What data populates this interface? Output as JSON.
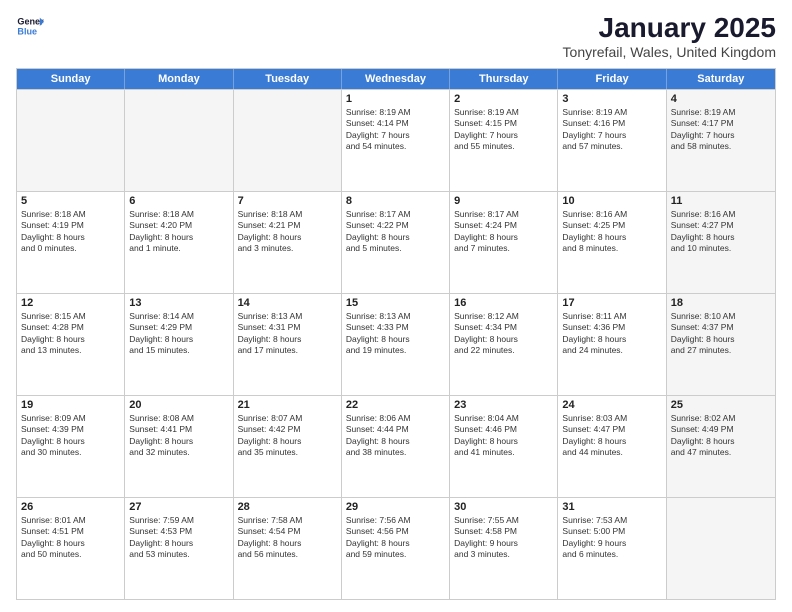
{
  "logo": {
    "line1": "General",
    "line2": "Blue"
  },
  "title": "January 2025",
  "subtitle": "Tonyrefail, Wales, United Kingdom",
  "header_days": [
    "Sunday",
    "Monday",
    "Tuesday",
    "Wednesday",
    "Thursday",
    "Friday",
    "Saturday"
  ],
  "weeks": [
    [
      {
        "day": "",
        "lines": [],
        "shaded": true
      },
      {
        "day": "",
        "lines": [],
        "shaded": true
      },
      {
        "day": "",
        "lines": [],
        "shaded": true
      },
      {
        "day": "1",
        "lines": [
          "Sunrise: 8:19 AM",
          "Sunset: 4:14 PM",
          "Daylight: 7 hours",
          "and 54 minutes."
        ]
      },
      {
        "day": "2",
        "lines": [
          "Sunrise: 8:19 AM",
          "Sunset: 4:15 PM",
          "Daylight: 7 hours",
          "and 55 minutes."
        ]
      },
      {
        "day": "3",
        "lines": [
          "Sunrise: 8:19 AM",
          "Sunset: 4:16 PM",
          "Daylight: 7 hours",
          "and 57 minutes."
        ]
      },
      {
        "day": "4",
        "lines": [
          "Sunrise: 8:19 AM",
          "Sunset: 4:17 PM",
          "Daylight: 7 hours",
          "and 58 minutes."
        ],
        "shaded": true
      }
    ],
    [
      {
        "day": "5",
        "lines": [
          "Sunrise: 8:18 AM",
          "Sunset: 4:19 PM",
          "Daylight: 8 hours",
          "and 0 minutes."
        ]
      },
      {
        "day": "6",
        "lines": [
          "Sunrise: 8:18 AM",
          "Sunset: 4:20 PM",
          "Daylight: 8 hours",
          "and 1 minute."
        ]
      },
      {
        "day": "7",
        "lines": [
          "Sunrise: 8:18 AM",
          "Sunset: 4:21 PM",
          "Daylight: 8 hours",
          "and 3 minutes."
        ]
      },
      {
        "day": "8",
        "lines": [
          "Sunrise: 8:17 AM",
          "Sunset: 4:22 PM",
          "Daylight: 8 hours",
          "and 5 minutes."
        ]
      },
      {
        "day": "9",
        "lines": [
          "Sunrise: 8:17 AM",
          "Sunset: 4:24 PM",
          "Daylight: 8 hours",
          "and 7 minutes."
        ]
      },
      {
        "day": "10",
        "lines": [
          "Sunrise: 8:16 AM",
          "Sunset: 4:25 PM",
          "Daylight: 8 hours",
          "and 8 minutes."
        ]
      },
      {
        "day": "11",
        "lines": [
          "Sunrise: 8:16 AM",
          "Sunset: 4:27 PM",
          "Daylight: 8 hours",
          "and 10 minutes."
        ],
        "shaded": true
      }
    ],
    [
      {
        "day": "12",
        "lines": [
          "Sunrise: 8:15 AM",
          "Sunset: 4:28 PM",
          "Daylight: 8 hours",
          "and 13 minutes."
        ]
      },
      {
        "day": "13",
        "lines": [
          "Sunrise: 8:14 AM",
          "Sunset: 4:29 PM",
          "Daylight: 8 hours",
          "and 15 minutes."
        ]
      },
      {
        "day": "14",
        "lines": [
          "Sunrise: 8:13 AM",
          "Sunset: 4:31 PM",
          "Daylight: 8 hours",
          "and 17 minutes."
        ]
      },
      {
        "day": "15",
        "lines": [
          "Sunrise: 8:13 AM",
          "Sunset: 4:33 PM",
          "Daylight: 8 hours",
          "and 19 minutes."
        ]
      },
      {
        "day": "16",
        "lines": [
          "Sunrise: 8:12 AM",
          "Sunset: 4:34 PM",
          "Daylight: 8 hours",
          "and 22 minutes."
        ]
      },
      {
        "day": "17",
        "lines": [
          "Sunrise: 8:11 AM",
          "Sunset: 4:36 PM",
          "Daylight: 8 hours",
          "and 24 minutes."
        ]
      },
      {
        "day": "18",
        "lines": [
          "Sunrise: 8:10 AM",
          "Sunset: 4:37 PM",
          "Daylight: 8 hours",
          "and 27 minutes."
        ],
        "shaded": true
      }
    ],
    [
      {
        "day": "19",
        "lines": [
          "Sunrise: 8:09 AM",
          "Sunset: 4:39 PM",
          "Daylight: 8 hours",
          "and 30 minutes."
        ]
      },
      {
        "day": "20",
        "lines": [
          "Sunrise: 8:08 AM",
          "Sunset: 4:41 PM",
          "Daylight: 8 hours",
          "and 32 minutes."
        ]
      },
      {
        "day": "21",
        "lines": [
          "Sunrise: 8:07 AM",
          "Sunset: 4:42 PM",
          "Daylight: 8 hours",
          "and 35 minutes."
        ]
      },
      {
        "day": "22",
        "lines": [
          "Sunrise: 8:06 AM",
          "Sunset: 4:44 PM",
          "Daylight: 8 hours",
          "and 38 minutes."
        ]
      },
      {
        "day": "23",
        "lines": [
          "Sunrise: 8:04 AM",
          "Sunset: 4:46 PM",
          "Daylight: 8 hours",
          "and 41 minutes."
        ]
      },
      {
        "day": "24",
        "lines": [
          "Sunrise: 8:03 AM",
          "Sunset: 4:47 PM",
          "Daylight: 8 hours",
          "and 44 minutes."
        ]
      },
      {
        "day": "25",
        "lines": [
          "Sunrise: 8:02 AM",
          "Sunset: 4:49 PM",
          "Daylight: 8 hours",
          "and 47 minutes."
        ],
        "shaded": true
      }
    ],
    [
      {
        "day": "26",
        "lines": [
          "Sunrise: 8:01 AM",
          "Sunset: 4:51 PM",
          "Daylight: 8 hours",
          "and 50 minutes."
        ]
      },
      {
        "day": "27",
        "lines": [
          "Sunrise: 7:59 AM",
          "Sunset: 4:53 PM",
          "Daylight: 8 hours",
          "and 53 minutes."
        ]
      },
      {
        "day": "28",
        "lines": [
          "Sunrise: 7:58 AM",
          "Sunset: 4:54 PM",
          "Daylight: 8 hours",
          "and 56 minutes."
        ]
      },
      {
        "day": "29",
        "lines": [
          "Sunrise: 7:56 AM",
          "Sunset: 4:56 PM",
          "Daylight: 8 hours",
          "and 59 minutes."
        ]
      },
      {
        "day": "30",
        "lines": [
          "Sunrise: 7:55 AM",
          "Sunset: 4:58 PM",
          "Daylight: 9 hours",
          "and 3 minutes."
        ]
      },
      {
        "day": "31",
        "lines": [
          "Sunrise: 7:53 AM",
          "Sunset: 5:00 PM",
          "Daylight: 9 hours",
          "and 6 minutes."
        ]
      },
      {
        "day": "",
        "lines": [],
        "shaded": true
      }
    ]
  ]
}
